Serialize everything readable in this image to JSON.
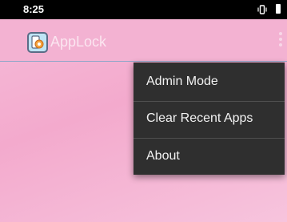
{
  "status_bar": {
    "time": "8:25",
    "icons": [
      "vibrate-icon",
      "battery-icon"
    ]
  },
  "app_bar": {
    "title": "AppLock",
    "icon": "applock-logo-icon",
    "overflow_icon": "more-vertical-icon"
  },
  "overflow_menu": {
    "items": [
      {
        "label": "Admin Mode"
      },
      {
        "label": "Clear Recent Apps"
      },
      {
        "label": "About"
      }
    ]
  },
  "colors": {
    "background": "#f3aacd",
    "app_bar": "#f3b2d2",
    "menu_background": "#2f2f2f",
    "status_bar": "#000000"
  }
}
